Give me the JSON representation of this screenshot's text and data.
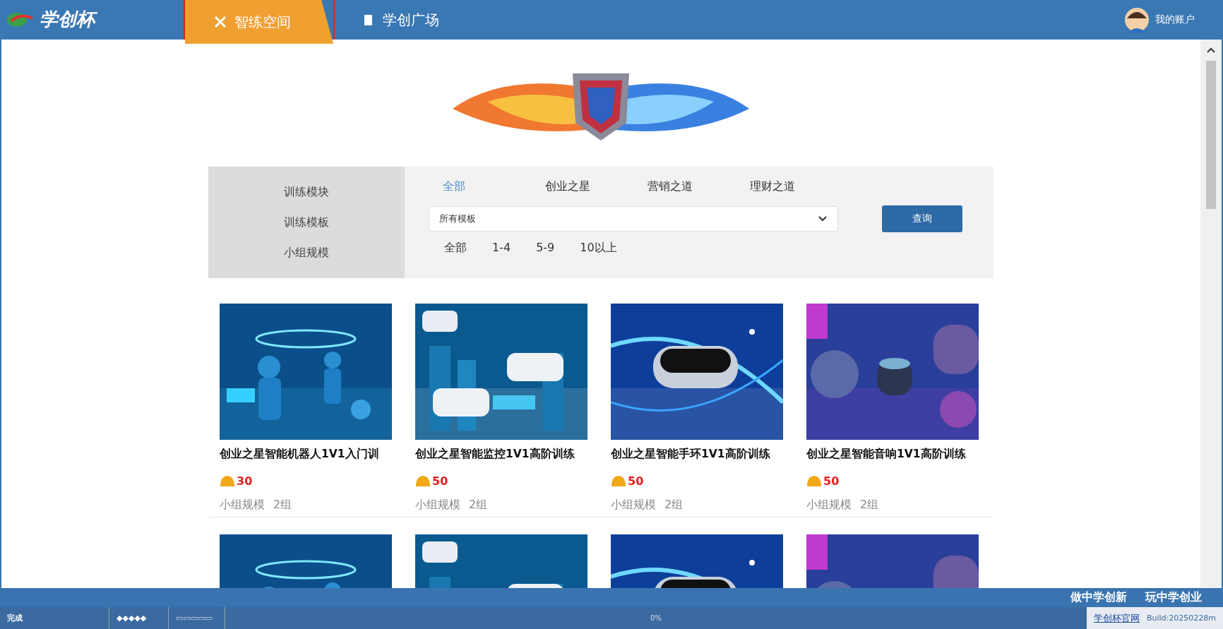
{
  "topbar": {
    "logo": "学创杯",
    "tabs": [
      {
        "label": "智练空间",
        "selected": true,
        "highlighted": true
      },
      {
        "label": "学创广场",
        "selected": false,
        "highlighted": false
      }
    ],
    "account": "我的账户"
  },
  "filters": {
    "labels": [
      "训练模块",
      "训练模板",
      "小组规模"
    ],
    "modules": [
      {
        "label": "全部",
        "selected": true
      },
      {
        "label": "创业之星",
        "selected": false
      },
      {
        "label": "营销之道",
        "selected": false
      },
      {
        "label": "理财之道",
        "selected": false
      }
    ],
    "template_select": {
      "value": "所有模板"
    },
    "query_button": "查询",
    "group_sizes": [
      "全部",
      "1-4",
      "5-9",
      "10以上"
    ]
  },
  "cards": [
    {
      "title": "创业之星智能机器人1V1入门训",
      "price": "30",
      "group_label": "小组规模",
      "group_value": "2组"
    },
    {
      "title": "创业之星智能监控1V1高阶训练",
      "price": "50",
      "group_label": "小组规模",
      "group_value": "2组"
    },
    {
      "title": "创业之星智能手环1V1高阶训练",
      "price": "50",
      "group_label": "小组规模",
      "group_value": "2组"
    },
    {
      "title": "创业之星智能音响1V1高阶训练",
      "price": "50",
      "group_label": "小组规模",
      "group_value": "2组"
    }
  ],
  "footer": {
    "slogans": [
      "做中学创新",
      "玩中学创业"
    ]
  },
  "status_bar": {
    "state": "完成",
    "indicator_1": "◆◆◆◆◆",
    "indicator_2": "▭▭▭▭▭",
    "progress_text": "0%",
    "link": "学创杯官网",
    "build": "Build:20250228m"
  }
}
